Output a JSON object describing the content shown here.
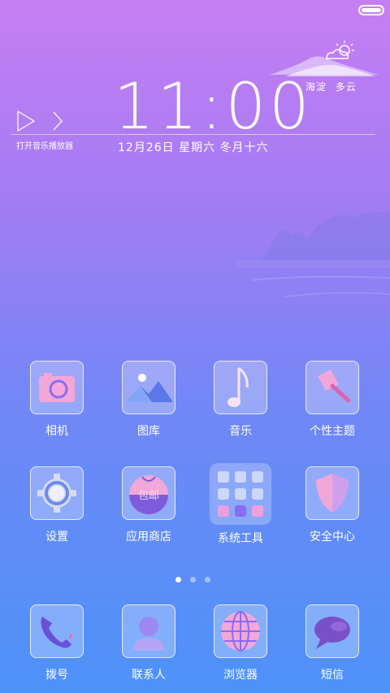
{
  "weather": {
    "location": "海淀",
    "condition": "多云",
    "icon": "partly-cloudy-icon"
  },
  "clock": {
    "time": "11:00",
    "date": "12月26日 星期六 冬月十六"
  },
  "music": {
    "label": "打开音乐播放器",
    "icons": [
      "play-icon",
      "next-icon"
    ]
  },
  "apps_row1": [
    {
      "label": "相机",
      "icon": "camera-icon"
    },
    {
      "label": "图库",
      "icon": "gallery-icon"
    },
    {
      "label": "音乐",
      "icon": "music-note-icon"
    },
    {
      "label": "个性主题",
      "icon": "theme-brush-icon"
    }
  ],
  "apps_row2": [
    {
      "label": "设置",
      "icon": "gear-icon"
    },
    {
      "label": "应用商店",
      "icon": "store-bag-icon",
      "badge_text": "包邮"
    },
    {
      "label": "系统工具",
      "icon": "folder-icon"
    },
    {
      "label": "安全中心",
      "icon": "shield-icon"
    }
  ],
  "dock": [
    {
      "label": "拨号",
      "icon": "phone-icon"
    },
    {
      "label": "联系人",
      "icon": "contact-icon"
    },
    {
      "label": "浏览器",
      "icon": "globe-icon"
    },
    {
      "label": "短信",
      "icon": "message-icon"
    }
  ],
  "page_indicator": {
    "count": 3,
    "active": 1
  },
  "colors": {
    "accent_pink": "#f0a0d8",
    "accent_purple": "#8a5cf0"
  }
}
